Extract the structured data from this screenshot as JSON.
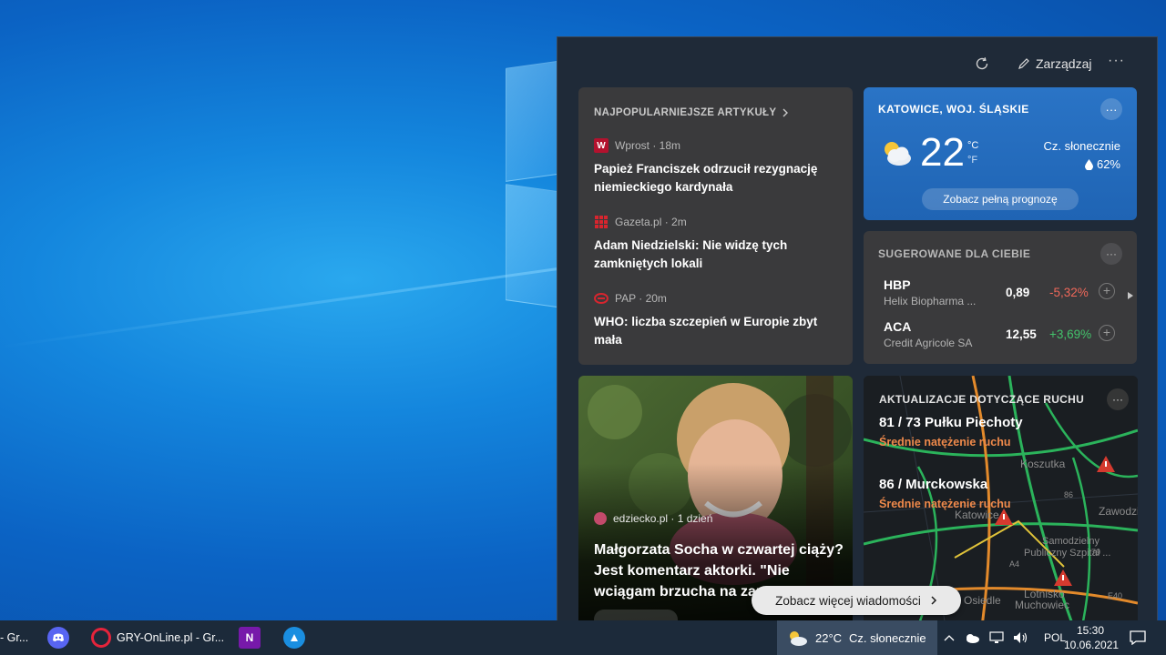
{
  "panel": {
    "manage_label": "Zarządzaj",
    "more_label": "···"
  },
  "top_articles": {
    "title": "NAJPOPULARNIEJSZE ARTYKUŁY",
    "items": [
      {
        "source": "Wprost · 18m",
        "headline": "Papież Franciszek odrzucił rezygnację niemieckiego kardynała",
        "logo_text": "W",
        "logo_color": "#b3122e"
      },
      {
        "source": "Gazeta.pl · 2m",
        "headline": "Adam Niedzielski: Nie widzę tych zamkniętych lokali",
        "logo_color": "#d8252e"
      },
      {
        "source": "PAP · 20m",
        "headline": "WHO: liczba szczepień w Europie zbyt mała",
        "logo_color": "#d8252e"
      }
    ]
  },
  "weather": {
    "location": "KATOWICE, WOJ. ŚLĄSKIE",
    "temperature": "22",
    "unit_c": "°C",
    "unit_f": "°F",
    "condition": "Cz. słonecznie",
    "humidity": "62%",
    "forecast_button": "Zobacz pełną prognozę",
    "more_label": "···"
  },
  "stocks": {
    "title": "SUGEROWANE DLA CIEBIE",
    "more_label": "···",
    "items": [
      {
        "symbol": "HBP",
        "name": "Helix Biopharma ...",
        "price": "0,89",
        "change": "-5,32%",
        "color": "#f0685a"
      },
      {
        "symbol": "ACA",
        "name": "Credit Agricole SA",
        "price": "12,55",
        "change": "+3,69%",
        "color": "#43c36b"
      }
    ]
  },
  "photo_article": {
    "source": "edziecko.pl · 1 dzień",
    "headline": "Małgorzata Socha w czwartej ciąży? Jest komentarz aktorki. \"Nie wciągam brzucha na zam..."
  },
  "traffic": {
    "title": "AKTUALIZACJE DOTYCZĄCE RUCHU",
    "more_label": "···",
    "roads": [
      {
        "name": "81 / 73 Pułku Piechoty",
        "status": "Średnie natężenie ruchu"
      },
      {
        "name": "86 / Murckowska",
        "status": "Średnie natężenie ruchu"
      }
    ],
    "map_labels": [
      "Koszutka",
      "Zawodzie",
      "Katowice",
      "Samodzielny",
      "Publiczny Szpital ...",
      "Lotnisko",
      "Muchowiec",
      "Osiedle",
      "A4",
      "E40",
      "86",
      "79"
    ]
  },
  "see_more_label": "Zobacz więcej wiadomości",
  "taskbar": {
    "left_label": "- Gr...",
    "browser_label": "GRY-OnLine.pl - Gr...",
    "weather_temp": "22°C",
    "weather_cond": "Cz. słonecznie",
    "language": "POL",
    "time": "15:30",
    "date": "10.06.2021"
  }
}
